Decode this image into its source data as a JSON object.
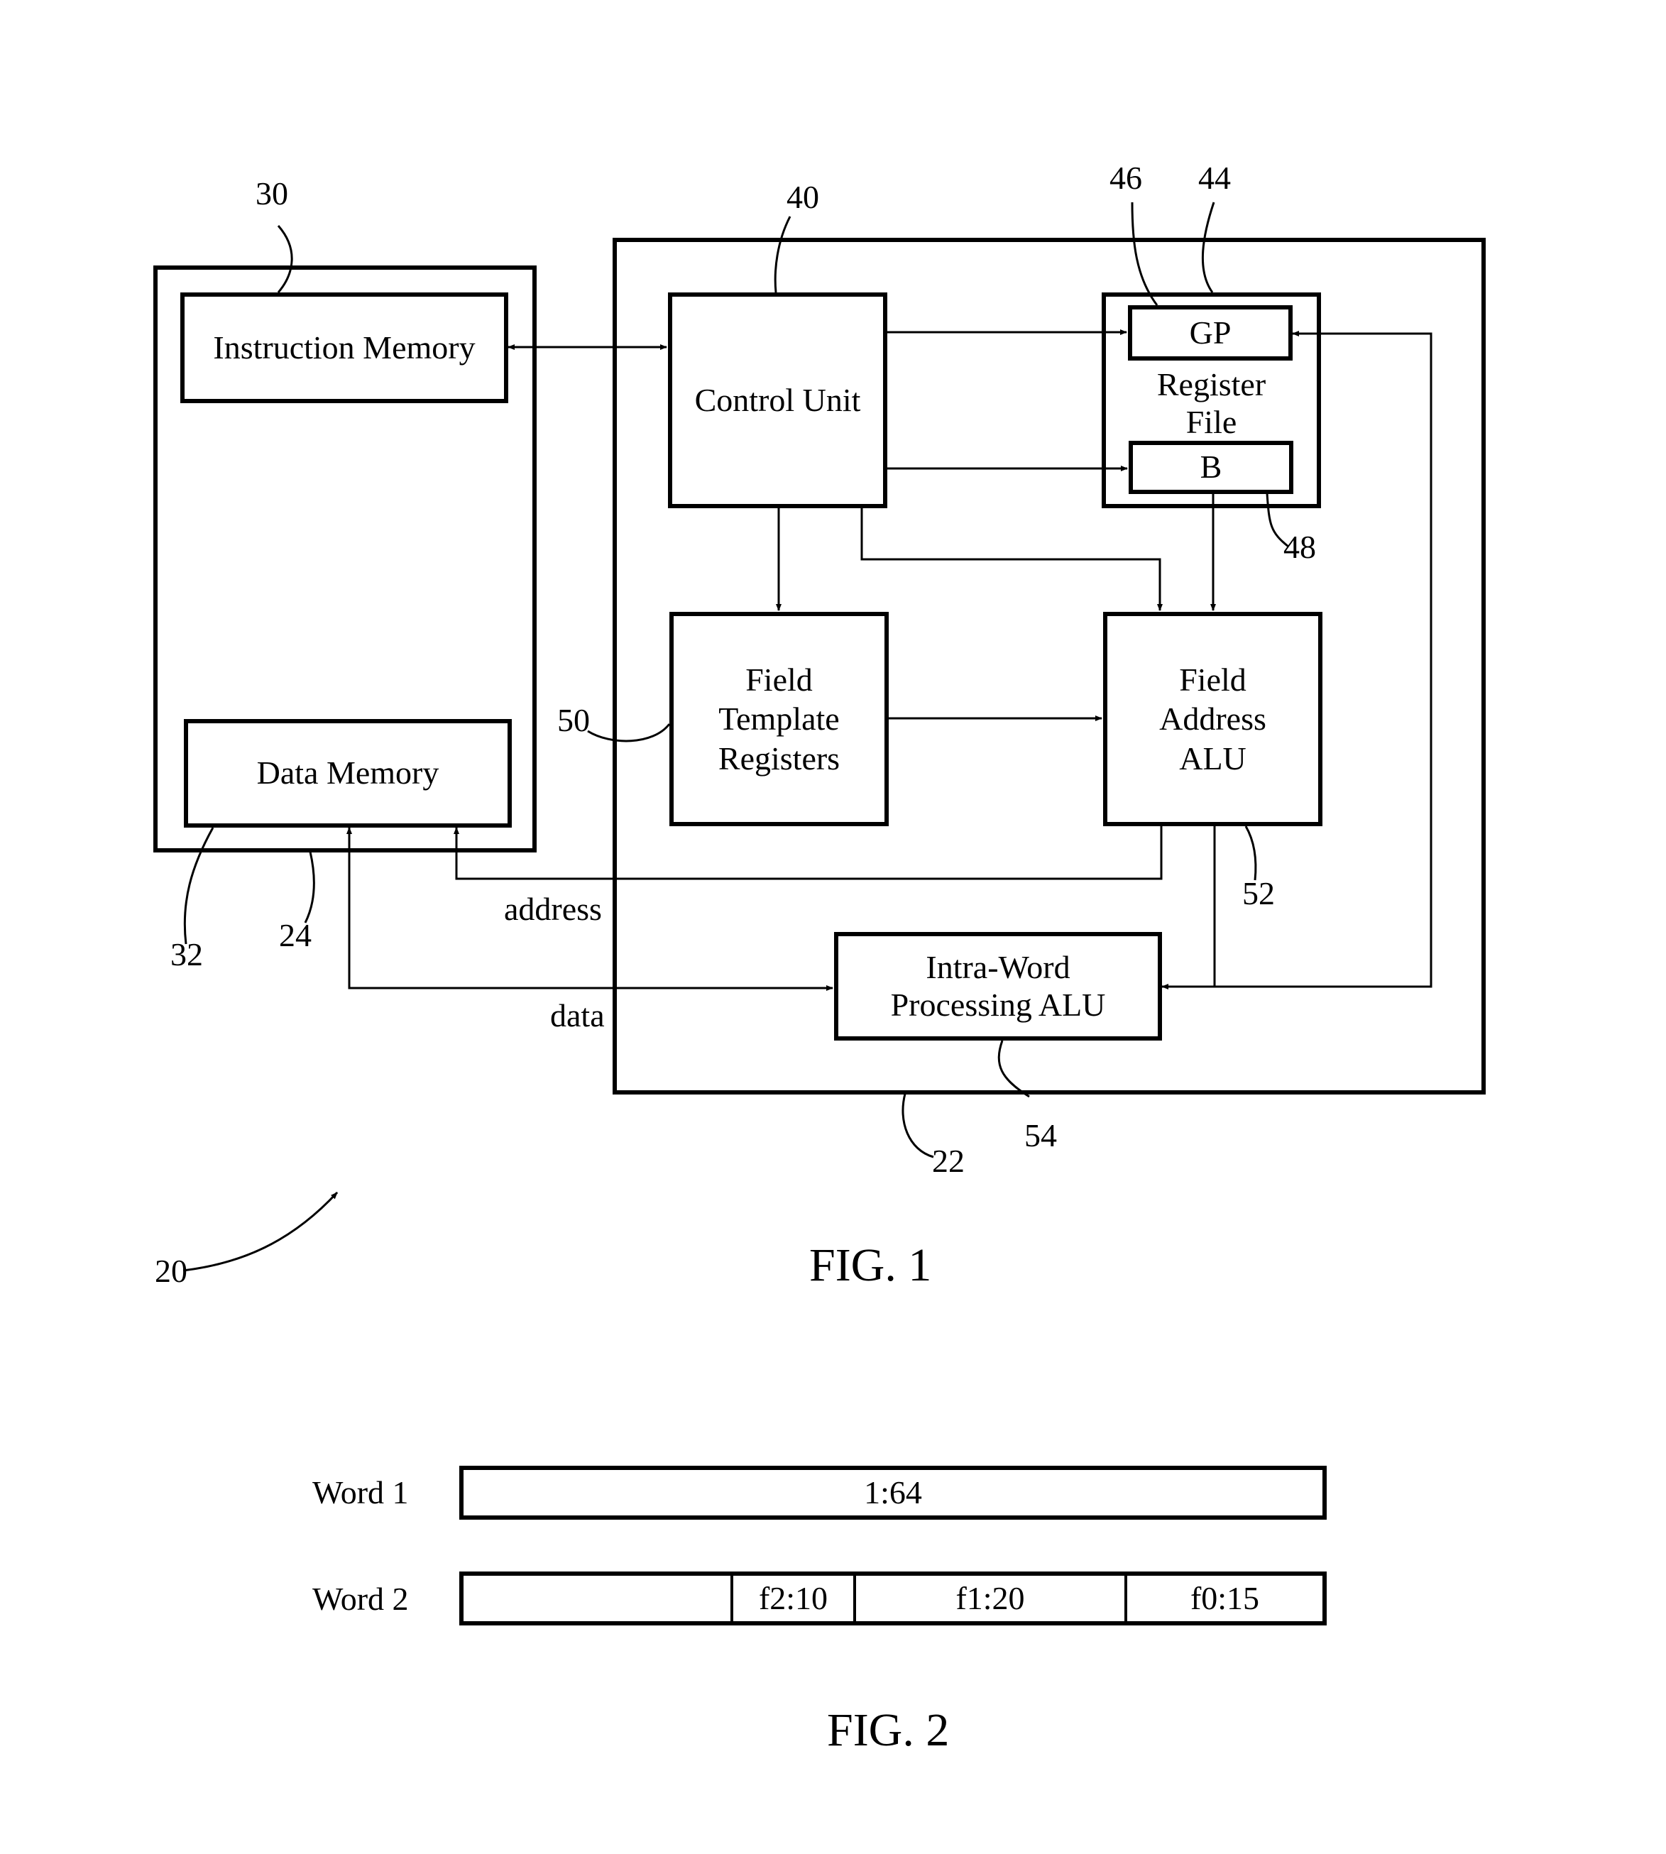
{
  "figure1": {
    "caption": "FIG. 1",
    "blocks": {
      "instruction_memory": {
        "label": "Instruction Memory",
        "ref": "30"
      },
      "data_memory": {
        "label": "Data Memory",
        "ref": "32"
      },
      "memory_unit": {
        "ref": "24"
      },
      "processor": {
        "ref": "22"
      },
      "control_unit": {
        "label": "Control Unit",
        "ref": "40"
      },
      "register_file": {
        "label": "Register File",
        "ref": "44"
      },
      "gp_register": {
        "label": "GP",
        "ref": "46"
      },
      "b_register": {
        "label": "B",
        "ref": "48"
      },
      "field_template_registers": {
        "label": "Field Template Registers",
        "ref": "50"
      },
      "field_address_alu": {
        "label": "Field Address ALU",
        "ref": "52"
      },
      "intra_word_alu": {
        "label": "Intra-Word Processing ALU",
        "ref": "54"
      }
    },
    "signals": {
      "address": "address",
      "data": "data"
    },
    "system_ref": "20"
  },
  "figure2": {
    "caption": "FIG. 2",
    "words": [
      {
        "label": "Word 1",
        "fields": [
          "1:64"
        ]
      },
      {
        "label": "Word 2",
        "fields": [
          "",
          "f2:10",
          "f1:20",
          "f0:15"
        ]
      }
    ]
  }
}
